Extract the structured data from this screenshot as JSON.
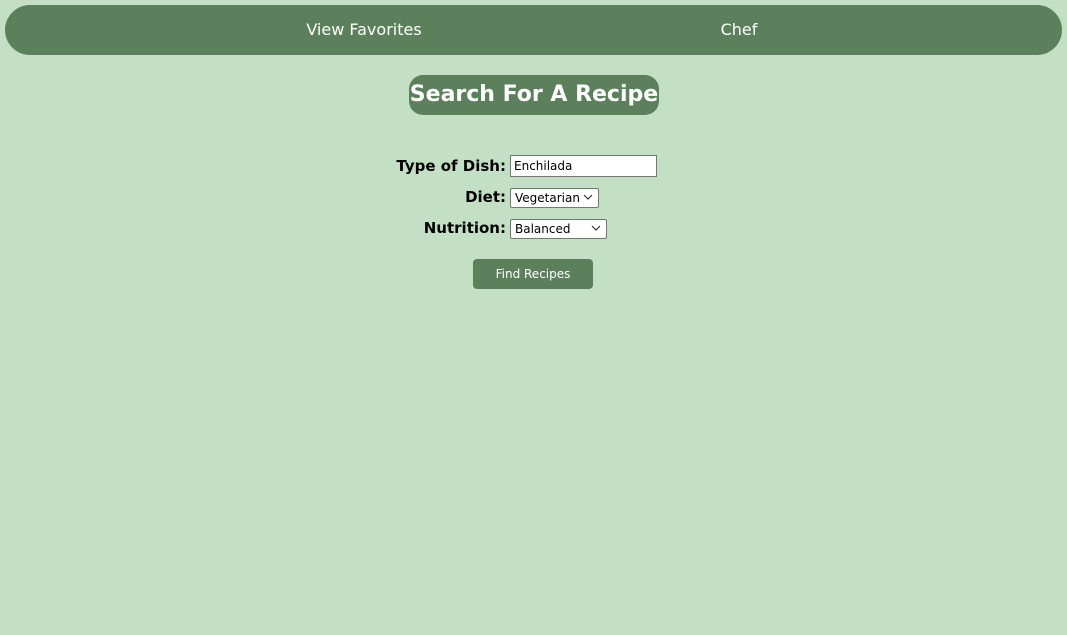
{
  "nav": {
    "favorites_label": "View Favorites",
    "chef_label": "Chef"
  },
  "page_title": "Search For A Recipe",
  "form": {
    "dish": {
      "label": "Type of Dish:",
      "value": "Enchilada"
    },
    "diet": {
      "label": "Diet:",
      "selected": "Vegetarian"
    },
    "nutrition": {
      "label": "Nutrition:",
      "selected": "Balanced"
    },
    "submit_label": "Find Recipes"
  },
  "colors": {
    "background": "#c4e0c4",
    "accent": "#5c805c",
    "text_light": "#ffffff",
    "text_dark": "#000000"
  },
  "icons": {
    "select_indicator": "chevron-down-icon"
  }
}
